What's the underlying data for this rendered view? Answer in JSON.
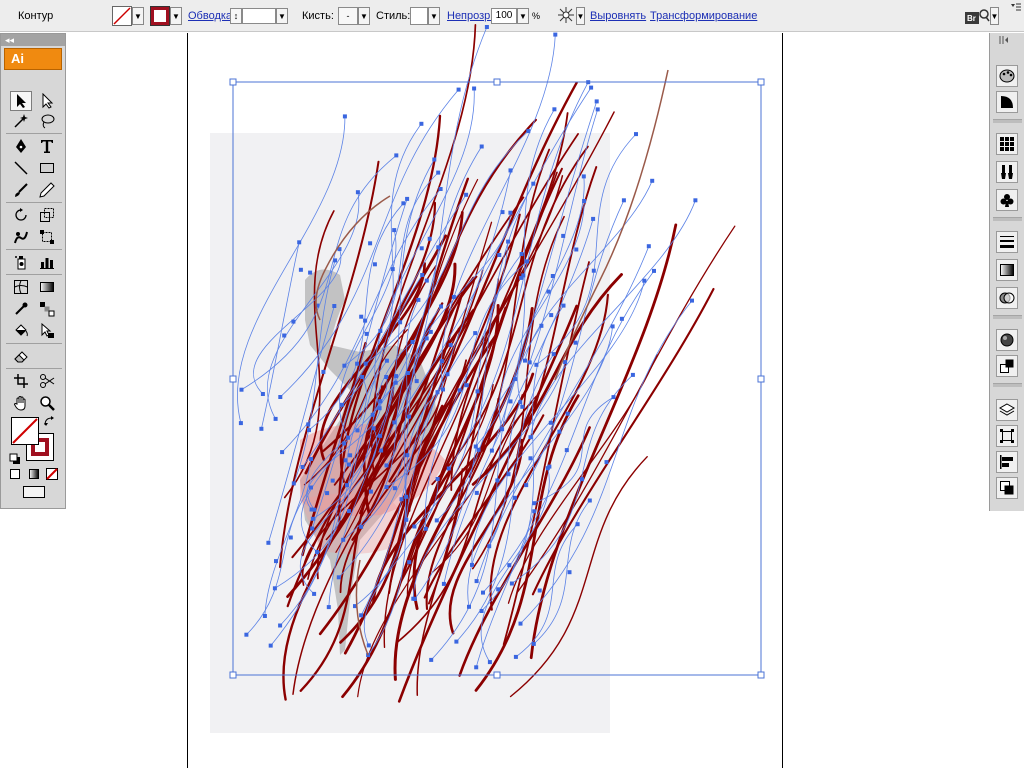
{
  "control_bar": {
    "selection_label": "Контур",
    "stroke_link": "Обводка:",
    "brush_label": "Кисть:",
    "brush_value": "-",
    "style_label": "Стиль:",
    "opacity_link": "Непрозр.:",
    "opacity_value": "100",
    "opacity_unit": "%",
    "align_link": "Выровнять",
    "transform_link": "Трансформирование",
    "bridge_label": "Br"
  },
  "tools_panel": {
    "logo": "Ai",
    "collapse_glyph": "◂◂"
  },
  "colors": {
    "stroke_red": "#8b0000",
    "anchor_blue": "#3a66e0",
    "bbox_blue": "#4b73d6",
    "ai_orange": "#f08a10"
  }
}
